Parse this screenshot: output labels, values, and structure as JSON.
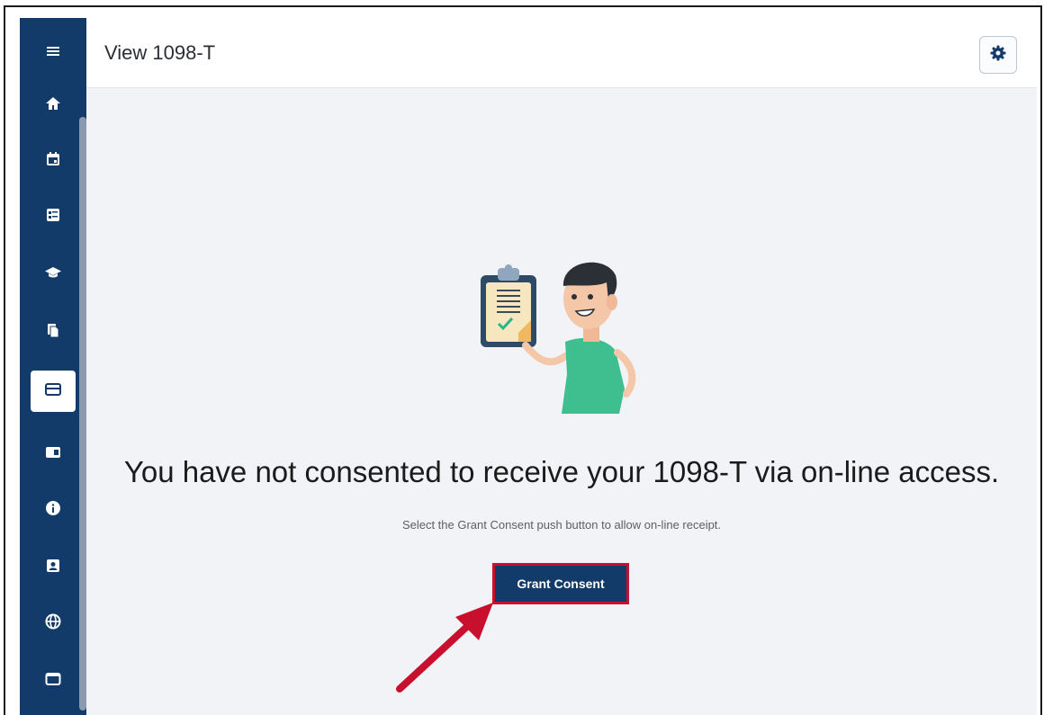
{
  "header": {
    "title": "View 1098-T",
    "settings_icon": "gear-icon"
  },
  "sidebar": {
    "items": [
      {
        "icon": "menu-icon"
      },
      {
        "icon": "home-icon"
      },
      {
        "icon": "calendar-icon"
      },
      {
        "icon": "list-card-icon"
      },
      {
        "icon": "graduation-cap-icon"
      },
      {
        "icon": "documents-icon"
      },
      {
        "icon": "credit-card-icon",
        "active": true
      },
      {
        "icon": "id-card-icon"
      },
      {
        "icon": "info-icon"
      },
      {
        "icon": "contact-card-icon"
      },
      {
        "icon": "globe-icon"
      },
      {
        "icon": "window-icon"
      }
    ]
  },
  "main": {
    "headline": "You have not consented to receive your 1098-T via on-line access.",
    "subtext": "Select the Grant Consent push button to allow on-line receipt.",
    "grant_button_label": "Grant Consent"
  },
  "colors": {
    "sidebar": "#133b6a",
    "button": "#133b6a",
    "highlight": "#c8102e",
    "background": "#f2f3f6"
  }
}
